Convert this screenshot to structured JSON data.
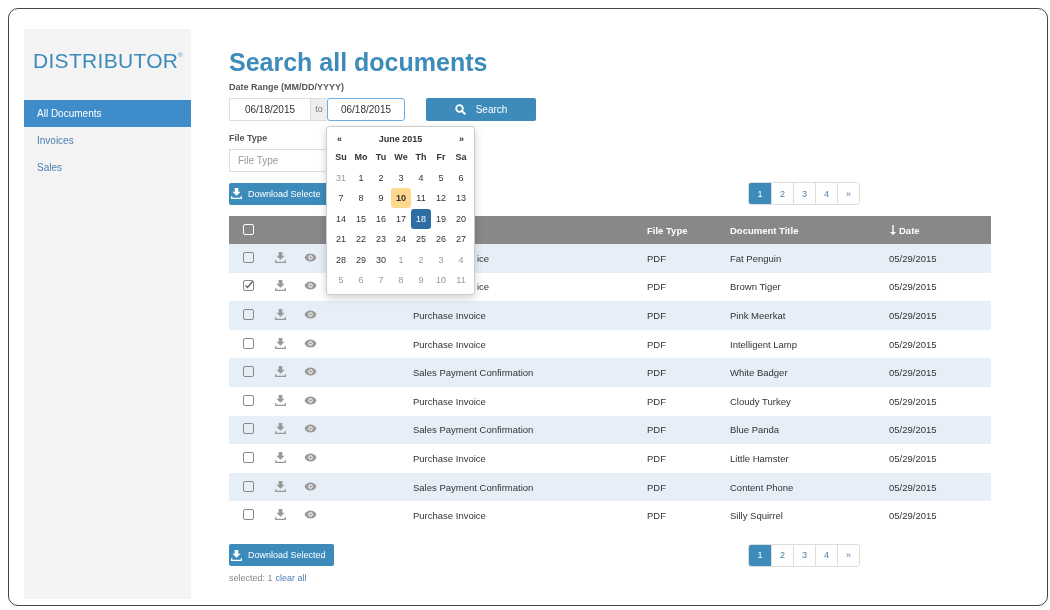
{
  "sidebar": {
    "logo": "DISTRIBUTOR",
    "logo_mark": "®",
    "items": [
      {
        "label": "All Documents",
        "selected": true
      },
      {
        "label": "Invoices",
        "selected": false
      },
      {
        "label": "Sales",
        "selected": false
      }
    ]
  },
  "title": "Search all documents",
  "date_range": {
    "label": "Date Range (MM/DD/YYYY)",
    "from": "06/18/2015",
    "separator": "to",
    "to": "06/18/2015",
    "focused": true
  },
  "search_button": "Search",
  "file_type": {
    "label": "File Type",
    "placeholder": "File Type"
  },
  "datepicker": {
    "open": true,
    "prev": "«",
    "month": "June 2015",
    "next": "»",
    "weekdays": [
      "Su",
      "Mo",
      "Tu",
      "We",
      "Th",
      "Fr",
      "Sa"
    ],
    "weeks": [
      [
        {
          "label": "31",
          "kind": "other",
          "selected": false
        },
        {
          "label": "1",
          "kind": "day",
          "selected": false
        },
        {
          "label": "2",
          "kind": "day",
          "selected": false
        },
        {
          "label": "3",
          "kind": "day",
          "selected": false
        },
        {
          "label": "4",
          "kind": "day",
          "selected": false
        },
        {
          "label": "5",
          "kind": "day",
          "selected": false
        },
        {
          "label": "6",
          "kind": "day",
          "selected": false
        }
      ],
      [
        {
          "label": "7",
          "kind": "day",
          "selected": false
        },
        {
          "label": "8",
          "kind": "day",
          "selected": false
        },
        {
          "label": "9",
          "kind": "day",
          "selected": false
        },
        {
          "label": "10",
          "kind": "today",
          "selected": false
        },
        {
          "label": "11",
          "kind": "day",
          "selected": false
        },
        {
          "label": "12",
          "kind": "day",
          "selected": false
        },
        {
          "label": "13",
          "kind": "day",
          "selected": false
        }
      ],
      [
        {
          "label": "14",
          "kind": "day",
          "selected": false
        },
        {
          "label": "15",
          "kind": "day",
          "selected": false
        },
        {
          "label": "16",
          "kind": "day",
          "selected": false
        },
        {
          "label": "17",
          "kind": "day",
          "selected": false
        },
        {
          "label": "18",
          "kind": "day",
          "selected": true
        },
        {
          "label": "19",
          "kind": "day",
          "selected": false
        },
        {
          "label": "20",
          "kind": "day",
          "selected": false
        }
      ],
      [
        {
          "label": "21",
          "kind": "day",
          "selected": false
        },
        {
          "label": "22",
          "kind": "day",
          "selected": false
        },
        {
          "label": "23",
          "kind": "day",
          "selected": false
        },
        {
          "label": "24",
          "kind": "day",
          "selected": false
        },
        {
          "label": "25",
          "kind": "day",
          "selected": false
        },
        {
          "label": "26",
          "kind": "day",
          "selected": false
        },
        {
          "label": "27",
          "kind": "day",
          "selected": false
        }
      ],
      [
        {
          "label": "28",
          "kind": "day",
          "selected": false
        },
        {
          "label": "29",
          "kind": "day",
          "selected": false
        },
        {
          "label": "30",
          "kind": "day",
          "selected": false
        },
        {
          "label": "1",
          "kind": "other",
          "selected": false
        },
        {
          "label": "2",
          "kind": "other",
          "selected": false
        },
        {
          "label": "3",
          "kind": "other",
          "selected": false
        },
        {
          "label": "4",
          "kind": "other",
          "selected": false
        }
      ],
      [
        {
          "label": "5",
          "kind": "other",
          "selected": false
        },
        {
          "label": "6",
          "kind": "other",
          "selected": false
        },
        {
          "label": "7",
          "kind": "other",
          "selected": false
        },
        {
          "label": "8",
          "kind": "other",
          "selected": false
        },
        {
          "label": "9",
          "kind": "other",
          "selected": false
        },
        {
          "label": "10",
          "kind": "other",
          "selected": false
        },
        {
          "label": "11",
          "kind": "other",
          "selected": false
        }
      ]
    ]
  },
  "download_button": "Download Selecte",
  "pagination": [
    {
      "label": "1",
      "selected": true
    },
    {
      "label": "2",
      "selected": false
    },
    {
      "label": "3",
      "selected": false
    },
    {
      "label": "4",
      "selected": false
    },
    {
      "label": "»",
      "selected": false
    }
  ],
  "table": {
    "select_all_checked": false,
    "columns": {
      "file_type": "File Type",
      "document_title": "Document Title",
      "date": "Date"
    },
    "rows": [
      {
        "checked": false,
        "document_type": "ice",
        "covered": true,
        "file_type": "PDF",
        "title": "Fat Penguin",
        "date": "05/29/2015"
      },
      {
        "checked": true,
        "document_type": "ice",
        "covered": true,
        "file_type": "PDF",
        "title": "Brown Tiger",
        "date": "05/29/2015"
      },
      {
        "checked": false,
        "document_type": "Purchase Invoice",
        "covered": false,
        "file_type": "PDF",
        "title": "Pink Meerkat",
        "date": "05/29/2015"
      },
      {
        "checked": false,
        "document_type": "Purchase Invoice",
        "covered": false,
        "file_type": "PDF",
        "title": "Intelligent Lamp",
        "date": "05/29/2015"
      },
      {
        "checked": false,
        "document_type": "Sales Payment Confirmation",
        "covered": false,
        "file_type": "PDF",
        "title": "White Badger",
        "date": "05/29/2015"
      },
      {
        "checked": false,
        "document_type": "Purchase Invoice",
        "covered": false,
        "file_type": "PDF",
        "title": "Cloudy Turkey",
        "date": "05/29/2015"
      },
      {
        "checked": false,
        "document_type": "Sales Payment Confirmation",
        "covered": false,
        "file_type": "PDF",
        "title": "Blue Panda",
        "date": "05/29/2015"
      },
      {
        "checked": false,
        "document_type": "Purchase Invoice",
        "covered": false,
        "file_type": "PDF",
        "title": "Little Hamster",
        "date": "05/29/2015"
      },
      {
        "checked": false,
        "document_type": "Sales Payment Confirmation",
        "covered": false,
        "file_type": "PDF",
        "title": "Content Phone",
        "date": "05/29/2015"
      },
      {
        "checked": false,
        "document_type": "Purchase Invoice",
        "covered": false,
        "file_type": "PDF",
        "title": "Silly Squirrel",
        "date": "05/29/2015"
      }
    ]
  },
  "bottom_download_button": "Download Selected",
  "bottom_pagination": [
    {
      "label": "1",
      "selected": true
    },
    {
      "label": "2",
      "selected": false
    },
    {
      "label": "3",
      "selected": false
    },
    {
      "label": "4",
      "selected": false
    },
    {
      "label": "»",
      "selected": false
    }
  ],
  "selection": {
    "label": "selected: 1",
    "clear": "clear all"
  }
}
